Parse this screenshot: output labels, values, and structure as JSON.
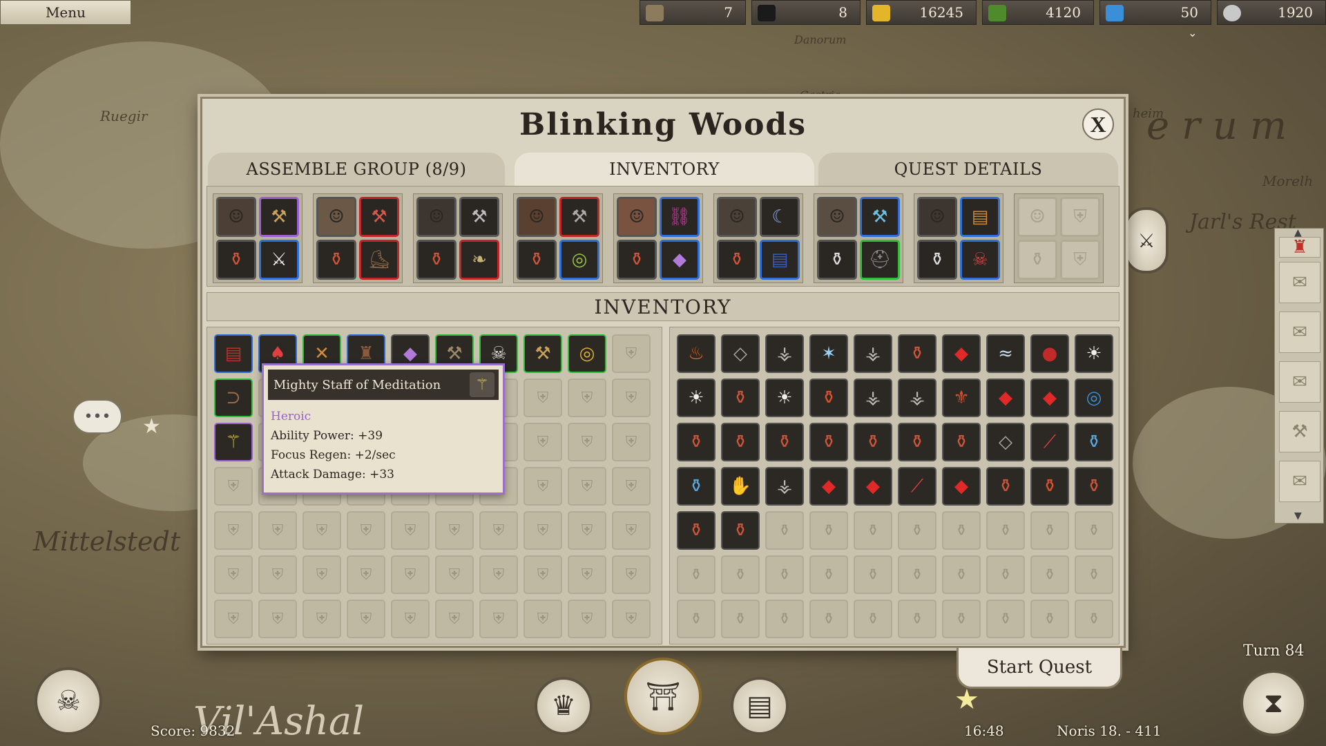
{
  "topbar": {
    "menu_label": "Menu",
    "resources": [
      {
        "icon": "building-icon",
        "value": "7",
        "color": "#8c7b5c"
      },
      {
        "icon": "population-icon",
        "value": "8",
        "color": "#1a1a1a"
      },
      {
        "icon": "gold-icon",
        "value": "16245",
        "color": "#e2b52a"
      },
      {
        "icon": "herb-icon",
        "value": "4120",
        "color": "#4f8a2c"
      },
      {
        "icon": "crystal-icon",
        "value": "50",
        "color": "#3a8fd8"
      },
      {
        "icon": "gear-icon",
        "value": "1920",
        "color": "#c8c8c8"
      }
    ]
  },
  "map_labels": {
    "ruegir": "Ruegir",
    "mittelstedt": "Mittelstedt",
    "vilashal": "Vil'Ashal",
    "jarls_rest": "Jarl's Rest",
    "danorum": "Danorum",
    "gastria": "Gastria",
    "heim": "heim",
    "morelh": "Morelh",
    "erum": "erum"
  },
  "dialog": {
    "title": "Blinking Woods",
    "close_label": "X",
    "tabs": {
      "assemble": "ASSEMBLE GROUP (8/9)",
      "inventory": "INVENTORY",
      "quest_details": "QUEST DETAILS"
    },
    "inventory_heading": "INVENTORY",
    "start_quest": "Start Quest"
  },
  "tooltip": {
    "name": "Mighty Staff  of Meditation",
    "rarity": "Heroic",
    "rarity_color": "#9c5fd1",
    "stats": [
      "Ability Power: +39",
      "Focus Regen: +2/sec",
      "Attack Damage: +33"
    ]
  },
  "hud": {
    "score": "Score: 9832",
    "time": "16:48",
    "date": "Noris 18. - 411",
    "turn": "Turn 84"
  }
}
